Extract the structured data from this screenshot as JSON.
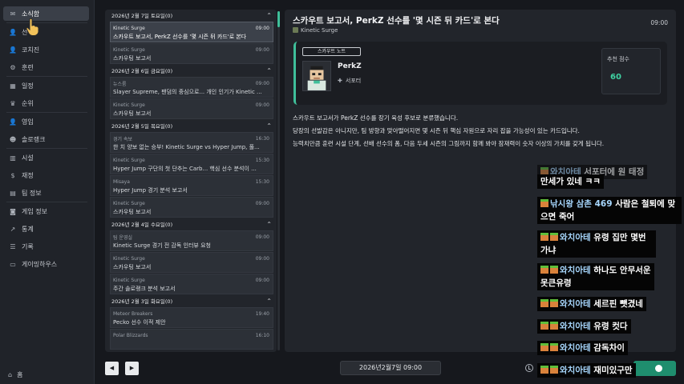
{
  "sidebar": {
    "items": [
      {
        "label": "소식함",
        "icon": "mail-icon"
      },
      {
        "label": "선수",
        "icon": "person-icon"
      },
      {
        "label": "코치진",
        "icon": "coach-icon"
      },
      {
        "label": "훈련",
        "icon": "training-icon"
      },
      {
        "label": "일정",
        "icon": "calendar-icon"
      },
      {
        "label": "순위",
        "icon": "trophy-icon"
      },
      {
        "label": "영입",
        "icon": "recruit-icon"
      },
      {
        "label": "솔로랭크",
        "icon": "solorank-icon"
      },
      {
        "label": "시설",
        "icon": "building-icon"
      },
      {
        "label": "재정",
        "icon": "finance-icon"
      },
      {
        "label": "팀 정보",
        "icon": "team-info-icon"
      },
      {
        "label": "게임 정보",
        "icon": "gamepad-icon"
      },
      {
        "label": "통계",
        "icon": "stats-icon"
      },
      {
        "label": "기록",
        "icon": "records-icon"
      },
      {
        "label": "게이밍하우스",
        "icon": "gaming-house-icon"
      }
    ],
    "home_label": "홈"
  },
  "inbox": {
    "groups": [
      {
        "date": "2026년 2월 7일 토요일(0)",
        "items": [
          {
            "team": "Kinetic Surge",
            "time": "09:00",
            "title": "스카우트 보고서, PerkZ 선수를 '몇 시즌 뒤 카드'로 본다",
            "selected": true
          },
          {
            "team": "Kinetic Surge",
            "time": "09:00",
            "title": "스카우팅 보고서"
          }
        ]
      },
      {
        "date": "2026년 2월 6일 금요일(0)",
        "items": [
          {
            "team": "뉴스룸",
            "time": "09:00",
            "title": "Slayer Supreme, 팬덤의 중심으로... 개인 인기가 Kinetic ..."
          },
          {
            "team": "Kinetic Surge",
            "time": "09:00",
            "title": "스카우팅 보고서"
          }
        ]
      },
      {
        "date": "2026년 2월 5일 목요일(0)",
        "items": [
          {
            "team": "경기 속보",
            "time": "16:30",
            "title": "한 치 양보 없는 승부! Kinetic Surge vs Hyper Jump, 풀..."
          },
          {
            "team": "Kinetic Surge",
            "time": "15:30",
            "title": "Hyper Jump 구단의 첫 단추는 Carb... 핵심 선수 분석이 ..."
          },
          {
            "team": "Misaya",
            "time": "15:30",
            "title": "Hyper Jump 경기 분석 보고서"
          },
          {
            "team": "Kinetic Surge",
            "time": "09:00",
            "title": "스카우팅 보고서"
          }
        ]
      },
      {
        "date": "2026년 2월 4일 수요일(0)",
        "items": [
          {
            "team": "팀 운영실",
            "time": "09:00",
            "title": "Kinetic Surge 경기 전 감독 인터뷰 요청"
          },
          {
            "team": "Kinetic Surge",
            "time": "09:00",
            "title": "스카우팅 보고서"
          },
          {
            "team": "Kinetic Surge",
            "time": "09:00",
            "title": "주간 솔로랭크 분석 보고서"
          }
        ]
      },
      {
        "date": "2026년 2월 3일 화요일(0)",
        "items": [
          {
            "team": "Meteor Breakers",
            "time": "19:40",
            "title": "Pecko 선수 이적 제안"
          },
          {
            "team": "Polar Blizzards",
            "time": "16:10",
            "title": ""
          }
        ]
      }
    ]
  },
  "detail": {
    "title": "스카우트 보고서, PerkZ 선수를 '몇 시즌 뒤 카드'로 본다",
    "time": "09:00",
    "team": "Kinetic Surge",
    "card_tag": "스카우트 노트",
    "player_name": "PerkZ",
    "player_role": "서포터",
    "rec_label": "추천 점수",
    "rec_value": "60",
    "body": [
      "스카우트 보고서가 PerkZ 선수를 장기 육성 후보로 분류했습니다.",
      "당장의 선발감은 아니지만, 팀 방향과 맞아떨어지면 몇 시즌 뒤 핵심 자원으로 자리 잡을 가능성이 있는 카드입니다.",
      "능력치만큼 훈련 시설 단계, 선배 선수의 폼, 다음 두세 시즌의 그림까지 함께 봐야 잠재력이 숫자 이상의 가치를 갖게 됩니다."
    ]
  },
  "bottom": {
    "prev_label": "◀",
    "next_label": "▶",
    "date_label": "2026년2월7일 09:00"
  },
  "chat": [
    {
      "nick": "와치아테",
      "text": "서포터에 원 태정",
      "faded": true
    },
    {
      "nick": "",
      "text": "만세가 있네 ㅋㅋ"
    },
    {
      "nick": "낚시왕 삼촌 469",
      "text": "사람은 철퇴에 맞으면 죽어"
    },
    {
      "nick": "와치아테",
      "text": "유령 집만 몇번가냐"
    },
    {
      "nick": "와치아테",
      "text": "하나도 안무서운 못큰유령"
    },
    {
      "nick": "와치아테",
      "text": "세르핀 뺏겼네"
    },
    {
      "nick": "와치아테",
      "text": "유령 컷다"
    },
    {
      "nick": "와치아테",
      "text": "감독차이"
    },
    {
      "nick": "와치아테",
      "text": "재미있구만"
    }
  ]
}
